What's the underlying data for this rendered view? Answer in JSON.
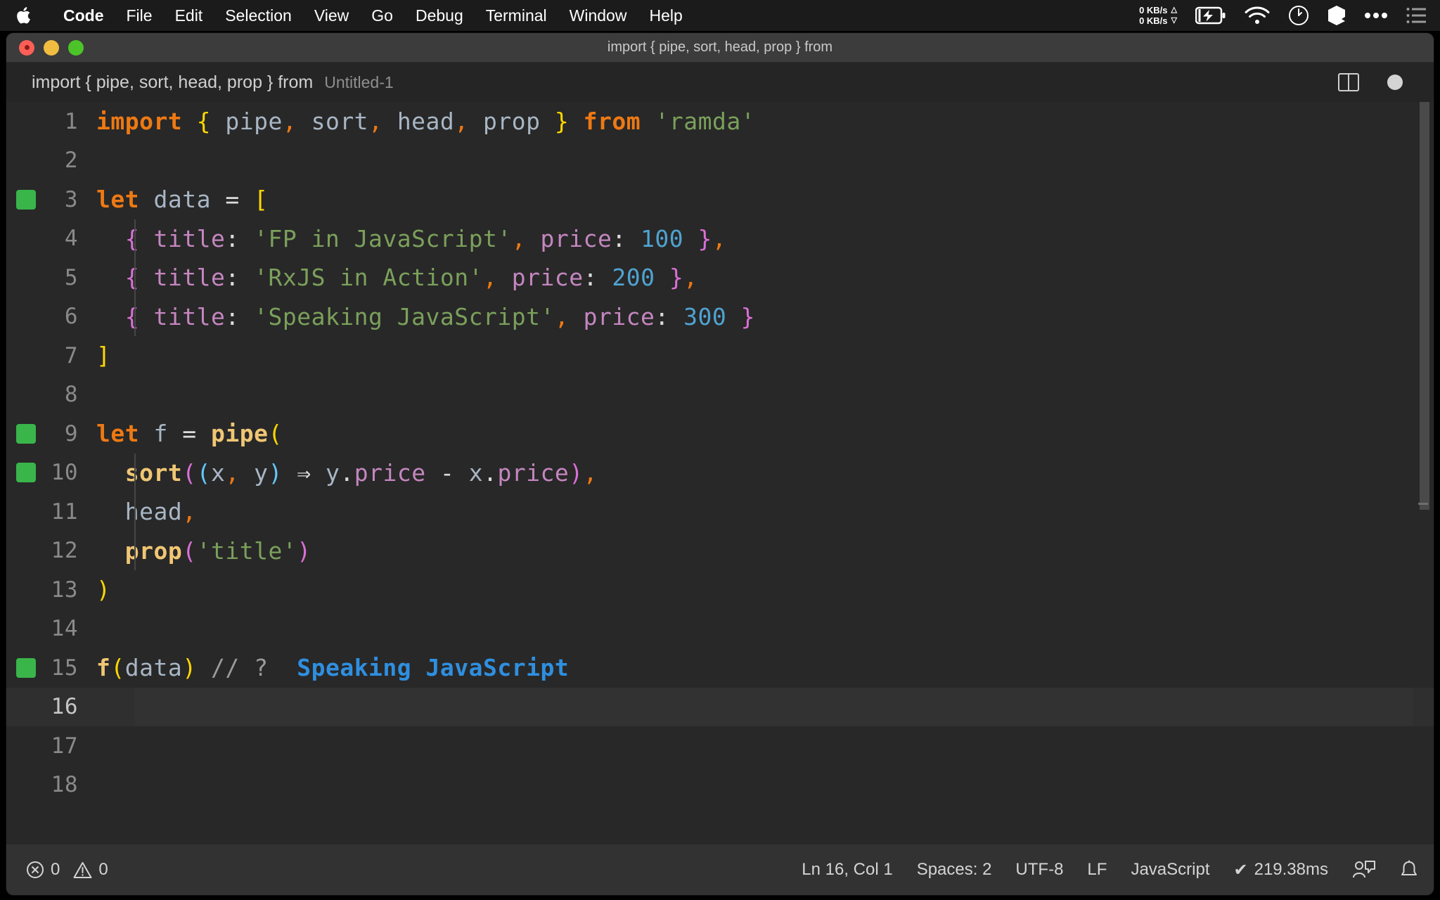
{
  "menubar": {
    "apple_icon": "apple-logo",
    "items": [
      {
        "label": "Code",
        "bold": true
      },
      {
        "label": "File",
        "bold": false
      },
      {
        "label": "Edit",
        "bold": false
      },
      {
        "label": "Selection",
        "bold": false
      },
      {
        "label": "View",
        "bold": false
      },
      {
        "label": "Go",
        "bold": false
      },
      {
        "label": "Debug",
        "bold": false
      },
      {
        "label": "Terminal",
        "bold": false
      },
      {
        "label": "Window",
        "bold": false
      },
      {
        "label": "Help",
        "bold": false
      }
    ],
    "status": {
      "net_up": "0 KB/s",
      "net_down": "0 KB/s",
      "up_arrow": "△",
      "down_arrow": "▽",
      "icons": [
        "battery-charging-icon",
        "wifi-icon",
        "clock-icon",
        "cube-icon",
        "ellipsis-icon",
        "list-icon"
      ]
    }
  },
  "window": {
    "title": "import { pipe, sort, head, prop } from",
    "traffic_lights": [
      "close-button",
      "minimize-button",
      "zoom-button"
    ]
  },
  "breadcrumb": {
    "main": "import { pipe, sort, head, prop } from",
    "file": "Untitled-1",
    "split_editor_icon": "split-editor-icon",
    "dirty_indicator": "unsaved-dot-icon"
  },
  "editor": {
    "lines": [
      {
        "num": "1",
        "marker": false,
        "indent": false,
        "current": false,
        "tokens": [
          {
            "t": "import",
            "c": "t-kw"
          },
          {
            "t": " ",
            "c": "t-punc"
          },
          {
            "t": "{",
            "c": "t-brace1"
          },
          {
            "t": " ",
            "c": "t-punc"
          },
          {
            "t": "pipe",
            "c": "t-id"
          },
          {
            "t": ",",
            "c": "t-comma"
          },
          {
            "t": " ",
            "c": "t-punc"
          },
          {
            "t": "sort",
            "c": "t-id"
          },
          {
            "t": ",",
            "c": "t-comma"
          },
          {
            "t": " ",
            "c": "t-punc"
          },
          {
            "t": "head",
            "c": "t-id"
          },
          {
            "t": ",",
            "c": "t-comma"
          },
          {
            "t": " ",
            "c": "t-punc"
          },
          {
            "t": "prop",
            "c": "t-id"
          },
          {
            "t": " ",
            "c": "t-punc"
          },
          {
            "t": "}",
            "c": "t-brace1"
          },
          {
            "t": " ",
            "c": "t-punc"
          },
          {
            "t": "from",
            "c": "t-kw"
          },
          {
            "t": " ",
            "c": "t-punc"
          },
          {
            "t": "'ramda'",
            "c": "t-str"
          }
        ]
      },
      {
        "num": "2",
        "marker": false,
        "indent": false,
        "current": false,
        "tokens": []
      },
      {
        "num": "3",
        "marker": true,
        "indent": false,
        "current": false,
        "tokens": [
          {
            "t": "let",
            "c": "t-kw"
          },
          {
            "t": " ",
            "c": "t-punc"
          },
          {
            "t": "data",
            "c": "t-id"
          },
          {
            "t": " ",
            "c": "t-punc"
          },
          {
            "t": "=",
            "c": "t-op"
          },
          {
            "t": " ",
            "c": "t-punc"
          },
          {
            "t": "[",
            "c": "t-brace1"
          }
        ]
      },
      {
        "num": "4",
        "marker": false,
        "indent": true,
        "current": false,
        "tokens": [
          {
            "t": "  ",
            "c": "t-punc"
          },
          {
            "t": "{",
            "c": "t-brace2"
          },
          {
            "t": " ",
            "c": "t-punc"
          },
          {
            "t": "title",
            "c": "t-prop"
          },
          {
            "t": ":",
            "c": "t-punc"
          },
          {
            "t": " ",
            "c": "t-punc"
          },
          {
            "t": "'FP in JavaScript'",
            "c": "t-str"
          },
          {
            "t": ",",
            "c": "t-comma"
          },
          {
            "t": " ",
            "c": "t-punc"
          },
          {
            "t": "price",
            "c": "t-prop"
          },
          {
            "t": ":",
            "c": "t-punc"
          },
          {
            "t": " ",
            "c": "t-punc"
          },
          {
            "t": "100",
            "c": "t-num"
          },
          {
            "t": " ",
            "c": "t-punc"
          },
          {
            "t": "}",
            "c": "t-brace2"
          },
          {
            "t": ",",
            "c": "t-comma"
          }
        ]
      },
      {
        "num": "5",
        "marker": false,
        "indent": true,
        "current": false,
        "tokens": [
          {
            "t": "  ",
            "c": "t-punc"
          },
          {
            "t": "{",
            "c": "t-brace2"
          },
          {
            "t": " ",
            "c": "t-punc"
          },
          {
            "t": "title",
            "c": "t-prop"
          },
          {
            "t": ":",
            "c": "t-punc"
          },
          {
            "t": " ",
            "c": "t-punc"
          },
          {
            "t": "'RxJS in Action'",
            "c": "t-str"
          },
          {
            "t": ",",
            "c": "t-comma"
          },
          {
            "t": " ",
            "c": "t-punc"
          },
          {
            "t": "price",
            "c": "t-prop"
          },
          {
            "t": ":",
            "c": "t-punc"
          },
          {
            "t": " ",
            "c": "t-punc"
          },
          {
            "t": "200",
            "c": "t-num"
          },
          {
            "t": " ",
            "c": "t-punc"
          },
          {
            "t": "}",
            "c": "t-brace2"
          },
          {
            "t": ",",
            "c": "t-comma"
          }
        ]
      },
      {
        "num": "6",
        "marker": false,
        "indent": true,
        "current": false,
        "tokens": [
          {
            "t": "  ",
            "c": "t-punc"
          },
          {
            "t": "{",
            "c": "t-brace2"
          },
          {
            "t": " ",
            "c": "t-punc"
          },
          {
            "t": "title",
            "c": "t-prop"
          },
          {
            "t": ":",
            "c": "t-punc"
          },
          {
            "t": " ",
            "c": "t-punc"
          },
          {
            "t": "'Speaking JavaScript'",
            "c": "t-str"
          },
          {
            "t": ",",
            "c": "t-comma"
          },
          {
            "t": " ",
            "c": "t-punc"
          },
          {
            "t": "price",
            "c": "t-prop"
          },
          {
            "t": ":",
            "c": "t-punc"
          },
          {
            "t": " ",
            "c": "t-punc"
          },
          {
            "t": "300",
            "c": "t-num"
          },
          {
            "t": " ",
            "c": "t-punc"
          },
          {
            "t": "}",
            "c": "t-brace2"
          }
        ]
      },
      {
        "num": "7",
        "marker": false,
        "indent": false,
        "current": false,
        "tokens": [
          {
            "t": "]",
            "c": "t-brace1"
          }
        ]
      },
      {
        "num": "8",
        "marker": false,
        "indent": false,
        "current": false,
        "tokens": []
      },
      {
        "num": "9",
        "marker": true,
        "indent": false,
        "current": false,
        "tokens": [
          {
            "t": "let",
            "c": "t-kw"
          },
          {
            "t": " ",
            "c": "t-punc"
          },
          {
            "t": "f",
            "c": "t-id"
          },
          {
            "t": " ",
            "c": "t-punc"
          },
          {
            "t": "=",
            "c": "t-op"
          },
          {
            "t": " ",
            "c": "t-punc"
          },
          {
            "t": "pipe",
            "c": "t-fn"
          },
          {
            "t": "(",
            "c": "t-brace1"
          }
        ]
      },
      {
        "num": "10",
        "marker": true,
        "indent": true,
        "current": false,
        "tokens": [
          {
            "t": "  ",
            "c": "t-punc"
          },
          {
            "t": "sort",
            "c": "t-fn"
          },
          {
            "t": "(",
            "c": "t-brace2"
          },
          {
            "t": "(",
            "c": "t-brace3"
          },
          {
            "t": "x",
            "c": "t-var"
          },
          {
            "t": ",",
            "c": "t-comma"
          },
          {
            "t": " ",
            "c": "t-punc"
          },
          {
            "t": "y",
            "c": "t-var"
          },
          {
            "t": ")",
            "c": "t-brace3"
          },
          {
            "t": " ",
            "c": "t-punc"
          },
          {
            "t": "⇒",
            "c": "t-op"
          },
          {
            "t": " ",
            "c": "t-punc"
          },
          {
            "t": "y",
            "c": "t-var"
          },
          {
            "t": ".",
            "c": "t-punc"
          },
          {
            "t": "price",
            "c": "t-member"
          },
          {
            "t": " ",
            "c": "t-punc"
          },
          {
            "t": "-",
            "c": "t-op"
          },
          {
            "t": " ",
            "c": "t-punc"
          },
          {
            "t": "x",
            "c": "t-var"
          },
          {
            "t": ".",
            "c": "t-punc"
          },
          {
            "t": "price",
            "c": "t-member"
          },
          {
            "t": ")",
            "c": "t-brace2"
          },
          {
            "t": ",",
            "c": "t-comma"
          }
        ]
      },
      {
        "num": "11",
        "marker": false,
        "indent": true,
        "current": false,
        "tokens": [
          {
            "t": "  ",
            "c": "t-punc"
          },
          {
            "t": "head",
            "c": "t-id"
          },
          {
            "t": ",",
            "c": "t-comma"
          }
        ]
      },
      {
        "num": "12",
        "marker": false,
        "indent": true,
        "current": false,
        "tokens": [
          {
            "t": "  ",
            "c": "t-punc"
          },
          {
            "t": "prop",
            "c": "t-fn"
          },
          {
            "t": "(",
            "c": "t-brace2"
          },
          {
            "t": "'title'",
            "c": "t-str"
          },
          {
            "t": ")",
            "c": "t-brace2"
          }
        ]
      },
      {
        "num": "13",
        "marker": false,
        "indent": false,
        "current": false,
        "tokens": [
          {
            "t": ")",
            "c": "t-brace1"
          }
        ]
      },
      {
        "num": "14",
        "marker": false,
        "indent": false,
        "current": false,
        "tokens": []
      },
      {
        "num": "15",
        "marker": true,
        "indent": false,
        "current": false,
        "tokens": [
          {
            "t": "f",
            "c": "t-fn"
          },
          {
            "t": "(",
            "c": "t-brace1"
          },
          {
            "t": "data",
            "c": "t-id"
          },
          {
            "t": ")",
            "c": "t-brace1"
          },
          {
            "t": " ",
            "c": "t-punc"
          },
          {
            "t": "// ?",
            "c": "t-comment"
          },
          {
            "t": "  ",
            "c": "t-punc"
          },
          {
            "t": "Speaking JavaScript",
            "c": "t-output"
          }
        ]
      },
      {
        "num": "16",
        "marker": false,
        "indent": false,
        "current": true,
        "tokens": []
      },
      {
        "num": "17",
        "marker": false,
        "indent": false,
        "current": false,
        "tokens": []
      },
      {
        "num": "18",
        "marker": false,
        "indent": false,
        "current": false,
        "tokens": []
      }
    ]
  },
  "statusbar": {
    "errors_icon": "error-circle-icon",
    "errors": "0",
    "warnings_icon": "warning-triangle-icon",
    "warnings": "0",
    "cursor_position": "Ln 16, Col 1",
    "indentation": "Spaces: 2",
    "encoding": "UTF-8",
    "eol": "LF",
    "language": "JavaScript",
    "quokka_check": "✔",
    "quokka_time": "219.38ms",
    "feedback_icon": "feedback-icon",
    "bell_icon": "bell-icon"
  },
  "colors": {
    "editor_bg": "#282828",
    "titlebar_bg": "#3c3c3c",
    "statusbar_bg": "#323233",
    "marker_green": "#39b54a",
    "output_blue": "#2f8fe0",
    "keyword_orange": "#ee7913",
    "string_green": "#7ba05b",
    "number_blue": "#4fa3d1",
    "property_pink": "#c586c0",
    "function_gold": "#f0c674"
  }
}
